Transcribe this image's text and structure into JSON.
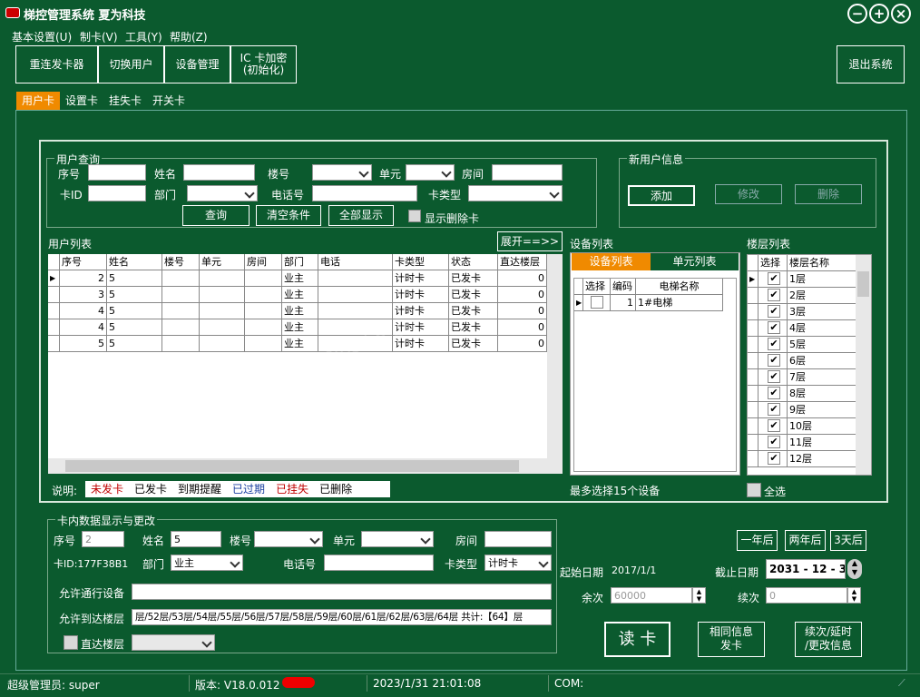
{
  "title": "梯控管理系统  夏为科技",
  "window_controls": {
    "min": "−",
    "max": "+",
    "close": "×"
  },
  "menu": [
    "基本设置(U)",
    "制卡(V)",
    "工具(Y)",
    "帮助(Z)"
  ],
  "toolbar": {
    "reconnect": "重连发卡器",
    "switch_user": "切换用户",
    "device_mgmt": "设备管理",
    "ic_encrypt_1": "IC 卡加密",
    "ic_encrypt_2": "(初始化)",
    "exit": "退出系统"
  },
  "tabs": [
    "用户卡",
    "设置卡",
    "挂失卡",
    "开关卡"
  ],
  "query": {
    "group_label": "用户查询",
    "seq": "序号",
    "name": "姓名",
    "building": "楼号",
    "unit": "单元",
    "room": "房间",
    "card_id": "卡ID",
    "dept": "部门",
    "phone": "电话号",
    "card_type": "卡类型",
    "btn_query": "查询",
    "btn_clear": "清空条件",
    "btn_all": "全部显示",
    "show_deleted": "显示删除卡"
  },
  "new_user": {
    "group_label": "新用户信息",
    "add": "添加",
    "modify": "修改",
    "delete": "删除"
  },
  "user_list": {
    "label": "用户列表",
    "expand": "展开==>>",
    "columns": [
      "序号",
      "姓名",
      "楼号",
      "单元",
      "房间",
      "部门",
      "电话",
      "卡类型",
      "状态",
      "直达楼层"
    ],
    "rows": [
      [
        "2",
        "5",
        "",
        "",
        "",
        "业主",
        "",
        "计时卡",
        "已发卡",
        "0"
      ],
      [
        "3",
        "5",
        "",
        "",
        "",
        "业主",
        "",
        "计时卡",
        "已发卡",
        "0"
      ],
      [
        "4",
        "5",
        "",
        "",
        "",
        "业主",
        "",
        "计时卡",
        "已发卡",
        "0"
      ],
      [
        "4",
        "5",
        "",
        "",
        "",
        "业主",
        "",
        "计时卡",
        "已发卡",
        "0"
      ],
      [
        "5",
        "5",
        "",
        "",
        "",
        "业主",
        "",
        "计时卡",
        "已发卡",
        "0"
      ]
    ],
    "overflow": "2"
  },
  "device_list": {
    "label": "设备列表",
    "tab_devices": "设备列表",
    "tab_units": "单元列表",
    "columns": [
      "选择",
      "编码",
      "电梯名称"
    ],
    "rows": [
      {
        "code": "1",
        "name": "1#电梯"
      }
    ],
    "note": "最多选择15个设备"
  },
  "floor_list": {
    "label": "楼层列表",
    "columns": [
      "选择",
      "楼层名称"
    ],
    "floors": [
      "1层",
      "2层",
      "3层",
      "4层",
      "5层",
      "6层",
      "7层",
      "8层",
      "9层",
      "10层",
      "11层",
      "12层"
    ],
    "select_all": "全选"
  },
  "legend": {
    "prefix": "说明:",
    "items": [
      {
        "text": "未发卡",
        "color": "#c00000"
      },
      {
        "text": "已发卡",
        "color": "#000000"
      },
      {
        "text": "到期提醒",
        "color": "#000000"
      },
      {
        "text": "已过期",
        "color": "#1a3fa0"
      },
      {
        "text": "已挂失",
        "color": "#c00000"
      },
      {
        "text": "已删除",
        "color": "#000000"
      }
    ]
  },
  "card": {
    "group_label": "卡内数据显示与更改",
    "seq": "序号",
    "seq_val": "2",
    "name": "姓名",
    "name_val": "5",
    "building": "楼号",
    "unit": "单元",
    "room": "房间",
    "card_id": "卡ID:177F38B1",
    "dept": "部门",
    "dept_val": "业主",
    "phone": "电话号",
    "card_type": "卡类型",
    "card_type_val": "计时卡",
    "allow_device": "允许通行设备",
    "allow_floor": "允许到达楼层",
    "allow_floor_val": "层/52层/53层/54层/55层/56层/57层/58层/59层/60层/61层/62层/63层/64层  共计:【64】层",
    "direct_floor": "直达楼层",
    "start_date_label": "起始日期",
    "start_date": "2017/1/1",
    "end_date_label": "截止日期",
    "end_date": "2031 - 12 - 31",
    "remain_label": "余次",
    "remain": "60000",
    "renew_label": "续次",
    "renew": "0",
    "btn_1y": "一年后",
    "btn_2y": "两年后",
    "btn_3d": "3天后",
    "btn_read": "读 卡",
    "btn_same_1": "相同信息",
    "btn_same_2": "发卡",
    "btn_renew_1": "续次/延时",
    "btn_renew_2": "/更改信息"
  },
  "status": {
    "admin": "超级管理员: super",
    "version": "版本: V18.0.012",
    "datetime": "2023/1/31 21:01:08",
    "com": "COM:"
  },
  "watermark": "www.admin365.cn"
}
